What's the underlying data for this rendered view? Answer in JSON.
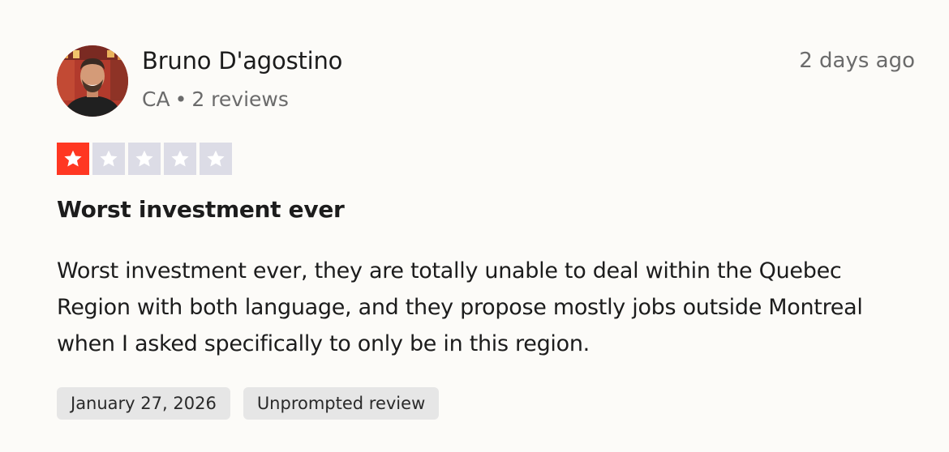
{
  "reviewer": {
    "name": "Bruno D'agostino",
    "country": "CA",
    "separator": "•",
    "review_count": "2 reviews"
  },
  "review": {
    "posted_ago": "2 days ago",
    "rating": 1,
    "max_rating": 5,
    "title": "Worst investment ever",
    "body": "Worst investment ever, they are totally unable to deal within the Quebec Region with both language, and they propose mostly jobs outside Montreal when I asked specifically to only be in this region.",
    "date_of_experience": "January 27, 2026",
    "source_label": "Unprompted review"
  },
  "colors": {
    "star_filled": "#ff3722",
    "star_empty": "#dcdce6",
    "tag_background": "#e6e6e6"
  },
  "icons": {
    "star": "star-icon"
  }
}
